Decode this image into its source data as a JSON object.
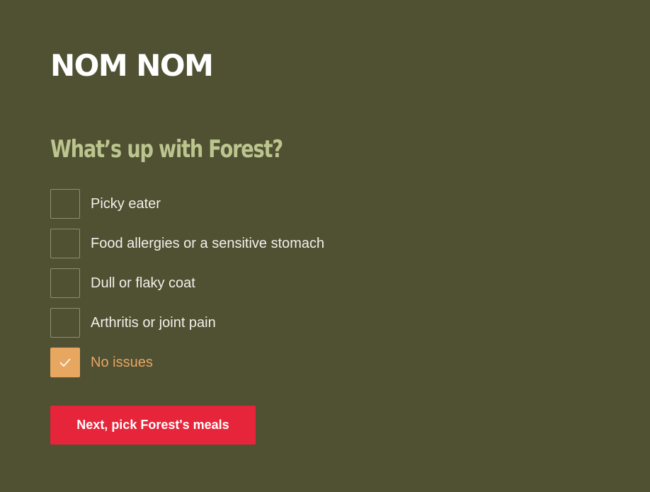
{
  "brand": {
    "logo_text": "NOM NOM"
  },
  "question": {
    "title": "What’s up with Forest?"
  },
  "options": [
    {
      "label": "Picky eater",
      "checked": false
    },
    {
      "label": "Food allergies or a sensitive stomach",
      "checked": false
    },
    {
      "label": "Dull or flaky coat",
      "checked": false
    },
    {
      "label": "Arthritis or joint pain",
      "checked": false
    },
    {
      "label": "No issues",
      "checked": true
    }
  ],
  "cta": {
    "label": "Next, pick Forest's meals"
  },
  "colors": {
    "background": "#505033",
    "heading": "#bcc58e",
    "accent_checked": "#e7a761",
    "cta": "#e7253a"
  },
  "icons": {
    "checkbox_checked": "checkmark-icon"
  }
}
